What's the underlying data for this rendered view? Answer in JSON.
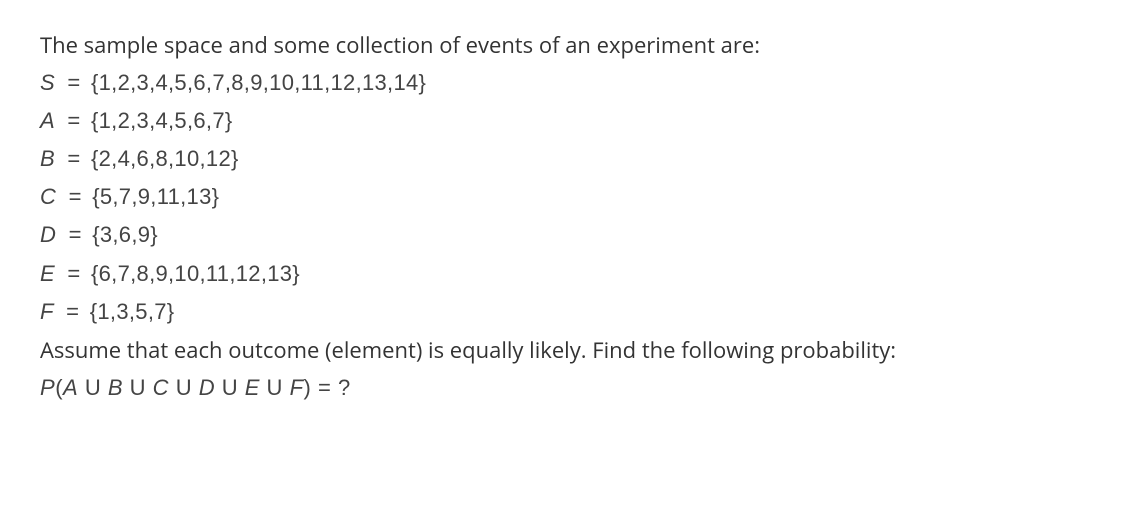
{
  "intro_text": "The sample space and some collection of events of an experiment are:",
  "sets": [
    {
      "name": "S",
      "values": "{1,2,3,4,5,6,7,8,9,10,11,12,13,14}"
    },
    {
      "name": "A",
      "values": "{1,2,3,4,5,6,7}"
    },
    {
      "name": "B",
      "values": "{2,4,6,8,10,12}"
    },
    {
      "name": "C",
      "values": "{5,7,9,11,13}"
    },
    {
      "name": "D",
      "values": "{3,6,9}"
    },
    {
      "name": "E",
      "values": "{6,7,8,9,10,11,12,13}"
    },
    {
      "name": "F",
      "values": "{1,3,5,7}"
    }
  ],
  "equals_sign": "=",
  "assume_text": "Assume that each outcome (element) is equally likely. Find the following probability:",
  "prob_expression": {
    "P": "P",
    "open": "(",
    "A": "A",
    "U1": "U",
    "B": "B",
    "U2": "U",
    "C": "C",
    "U3": "U",
    "D": "D",
    "U4": "U",
    "E": "E",
    "U5": "U",
    "F": "F",
    "close": ")",
    "eq": "=",
    "q": "?"
  }
}
